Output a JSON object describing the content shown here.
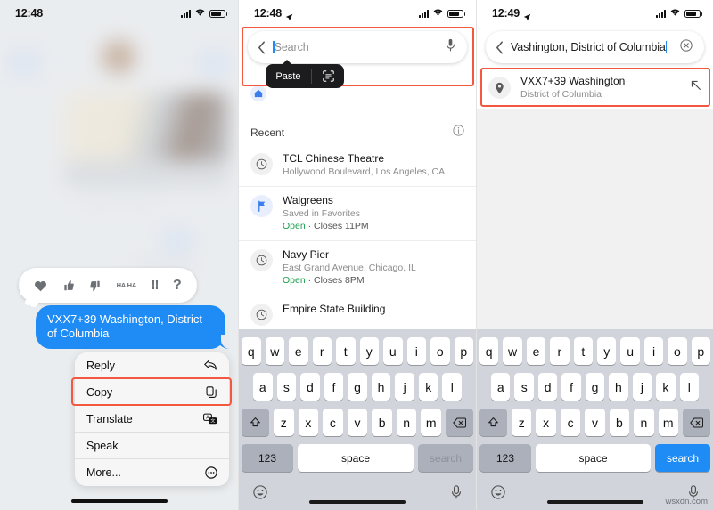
{
  "panel1": {
    "status": {
      "time": "12:48",
      "location_arrow": false,
      "signal": "cellular-bars-icon",
      "wifi": "wifi-icon",
      "battery": "battery-icon"
    },
    "reactions": [
      {
        "name": "heart",
        "label": ""
      },
      {
        "name": "thumbs-up",
        "label": ""
      },
      {
        "name": "thumbs-down",
        "label": ""
      },
      {
        "name": "haha",
        "label": "HA HA"
      },
      {
        "name": "exclamation",
        "label": "!!"
      },
      {
        "name": "question",
        "label": "?"
      }
    ],
    "message": {
      "text": "VXX7+39 Washington, District of Columbia",
      "bubble_color": "#1f8cf6"
    },
    "context_menu": [
      {
        "label": "Reply",
        "icon": "reply-arrow-icon"
      },
      {
        "label": "Copy",
        "icon": "copy-icon"
      },
      {
        "label": "Translate",
        "icon": "translate-icon"
      },
      {
        "label": "Speak",
        "icon": ""
      },
      {
        "label": "More...",
        "icon": "more-ellipsis-icon"
      }
    ],
    "highlight_color": "#f4573f",
    "highlighted_item": "Copy"
  },
  "panel2": {
    "status": {
      "time": "12:48"
    },
    "search": {
      "value": "",
      "placeholder": "Search",
      "mic_icon": "microphone-icon",
      "back_icon": "chevron-left-icon"
    },
    "paste_popup": {
      "label": "Paste",
      "scan_icon": "scan-text-icon"
    },
    "recent": {
      "header": "Recent",
      "info_icon": "info-circle-icon",
      "items": [
        {
          "title": "TCL Chinese Theatre",
          "subtitle": "Hollywood Boulevard, Los Angeles, CA",
          "status": "",
          "status_open": "",
          "icon": "clock-icon"
        },
        {
          "title": "Walgreens",
          "subtitle": "Saved in Favorites",
          "status_open": "Open",
          "status": " · Closes 11PM",
          "icon": "favorite-flag-icon"
        },
        {
          "title": "Navy Pier",
          "subtitle": "East Grand Avenue, Chicago, IL",
          "status_open": "Open",
          "status": " · Closes 8PM",
          "icon": "clock-icon"
        },
        {
          "title": "Empire State Building",
          "subtitle": "",
          "status_open": "",
          "status": "",
          "icon": "clock-icon"
        }
      ]
    },
    "keyboard": {
      "row1": [
        "q",
        "w",
        "e",
        "r",
        "t",
        "y",
        "u",
        "i",
        "o",
        "p"
      ],
      "row2": [
        "a",
        "s",
        "d",
        "f",
        "g",
        "h",
        "j",
        "k",
        "l"
      ],
      "row3": [
        "z",
        "x",
        "c",
        "v",
        "b",
        "n",
        "m"
      ],
      "shift_icon": "shift-icon",
      "backspace_icon": "backspace-icon",
      "numbers_key": "123",
      "space_key": "space",
      "action_key": "search",
      "action_enabled": false,
      "emoji_icon": "emoji-icon",
      "dictation_icon": "microphone-icon"
    }
  },
  "panel3": {
    "status": {
      "time": "12:49"
    },
    "search": {
      "value": "Vashington, District of Columbia",
      "clear_icon": "clear-circle-icon",
      "back_icon": "chevron-left-icon"
    },
    "result": {
      "title": "VXX7+39 Washington",
      "subtitle": "District of Columbia",
      "pin_icon": "map-pin-icon",
      "fill_icon": "arrow-up-left-icon"
    },
    "highlight_color": "#f4573f",
    "keyboard": {
      "row1": [
        "q",
        "w",
        "e",
        "r",
        "t",
        "y",
        "u",
        "i",
        "o",
        "p"
      ],
      "row2": [
        "a",
        "s",
        "d",
        "f",
        "g",
        "h",
        "j",
        "k",
        "l"
      ],
      "row3": [
        "z",
        "x",
        "c",
        "v",
        "b",
        "n",
        "m"
      ],
      "numbers_key": "123",
      "space_key": "space",
      "action_key": "search",
      "action_enabled": true,
      "emoji_icon": "emoji-icon",
      "dictation_icon": "microphone-icon"
    },
    "watermark": "wsxdn.com"
  }
}
